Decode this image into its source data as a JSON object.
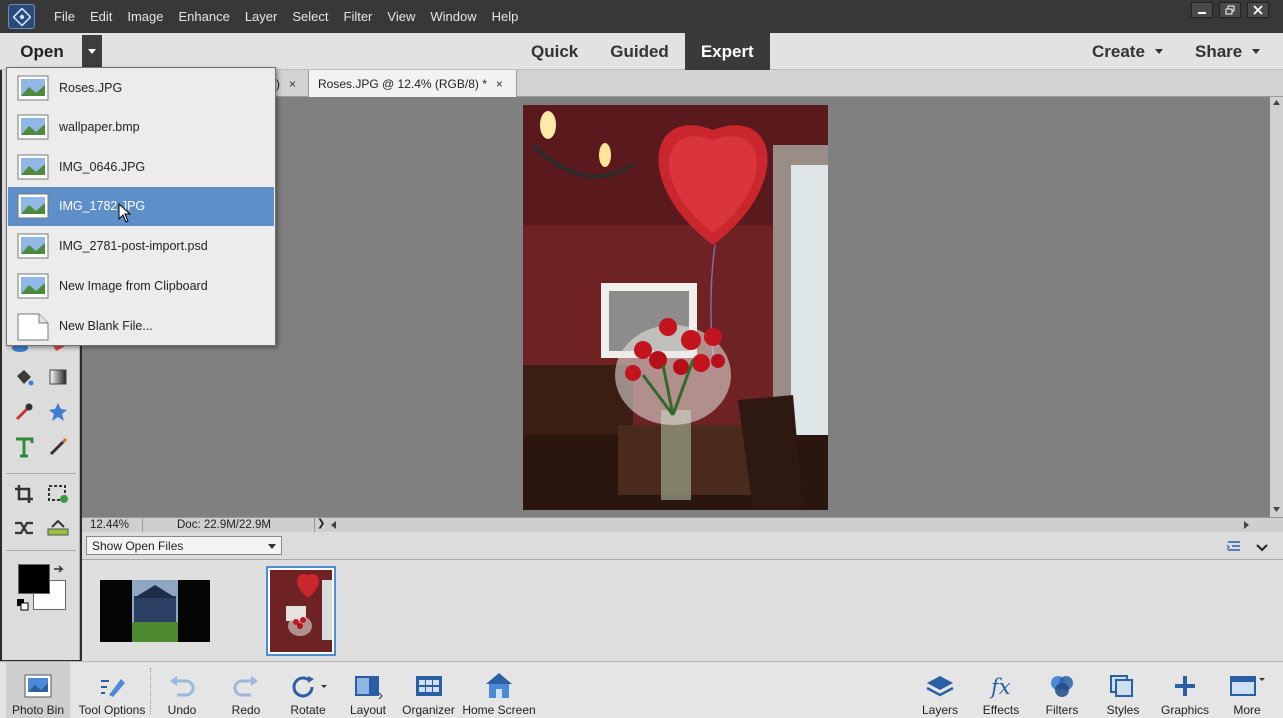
{
  "menubar": {
    "items": [
      "File",
      "Edit",
      "Image",
      "Enhance",
      "Layer",
      "Select",
      "Filter",
      "View",
      "Window",
      "Help"
    ]
  },
  "modebar": {
    "open_label": "Open",
    "modes": [
      "Quick",
      "Guided",
      "Expert"
    ],
    "active_mode": "Expert",
    "create_label": "Create",
    "share_label": "Share"
  },
  "open_menu": {
    "items": [
      {
        "label": "Roses.JPG",
        "icon": "image-file-icon"
      },
      {
        "label": "wallpaper.bmp",
        "icon": "image-file-icon"
      },
      {
        "label": "IMG_0646.JPG",
        "icon": "image-file-icon"
      },
      {
        "label": "IMG_1782.JPG",
        "icon": "image-file-icon",
        "hovered": true
      },
      {
        "label": "IMG_2781-post-import.psd",
        "icon": "image-file-icon"
      },
      {
        "label": "New Image from Clipboard",
        "icon": "image-file-icon"
      },
      {
        "label": "New Blank File...",
        "icon": "blank-file-icon"
      }
    ]
  },
  "document": {
    "tab_title": "Roses.JPG @ 12.4% (RGB/8) *",
    "hidden_tab_fragment": ")",
    "close_glyph": "×"
  },
  "status": {
    "zoom": "12.44%",
    "doc_size": "Doc: 22.9M/22.9M"
  },
  "photo_bin": {
    "filter_label": "Show Open Files"
  },
  "taskbar": {
    "left": [
      {
        "label": "Photo Bin",
        "icon": "photo-bin-icon"
      },
      {
        "label": "Tool Options",
        "icon": "tool-options-icon"
      },
      {
        "label": "Undo",
        "icon": "undo-icon"
      },
      {
        "label": "Redo",
        "icon": "redo-icon"
      },
      {
        "label": "Rotate",
        "icon": "rotate-icon"
      },
      {
        "label": "Layout",
        "icon": "layout-icon"
      },
      {
        "label": "Organizer",
        "icon": "organizer-icon"
      },
      {
        "label": "Home Screen",
        "icon": "home-icon"
      }
    ],
    "right": [
      {
        "label": "Layers",
        "icon": "layers-icon"
      },
      {
        "label": "Effects",
        "icon": "fx-icon"
      },
      {
        "label": "Filters",
        "icon": "filters-icon"
      },
      {
        "label": "Styles",
        "icon": "styles-icon"
      },
      {
        "label": "Graphics",
        "icon": "graphics-icon"
      },
      {
        "label": "More",
        "icon": "more-icon"
      }
    ]
  },
  "colors": {
    "accent_blue": "#5e8fc9",
    "foreground_color": "#000000",
    "background_color": "#ffffff"
  }
}
